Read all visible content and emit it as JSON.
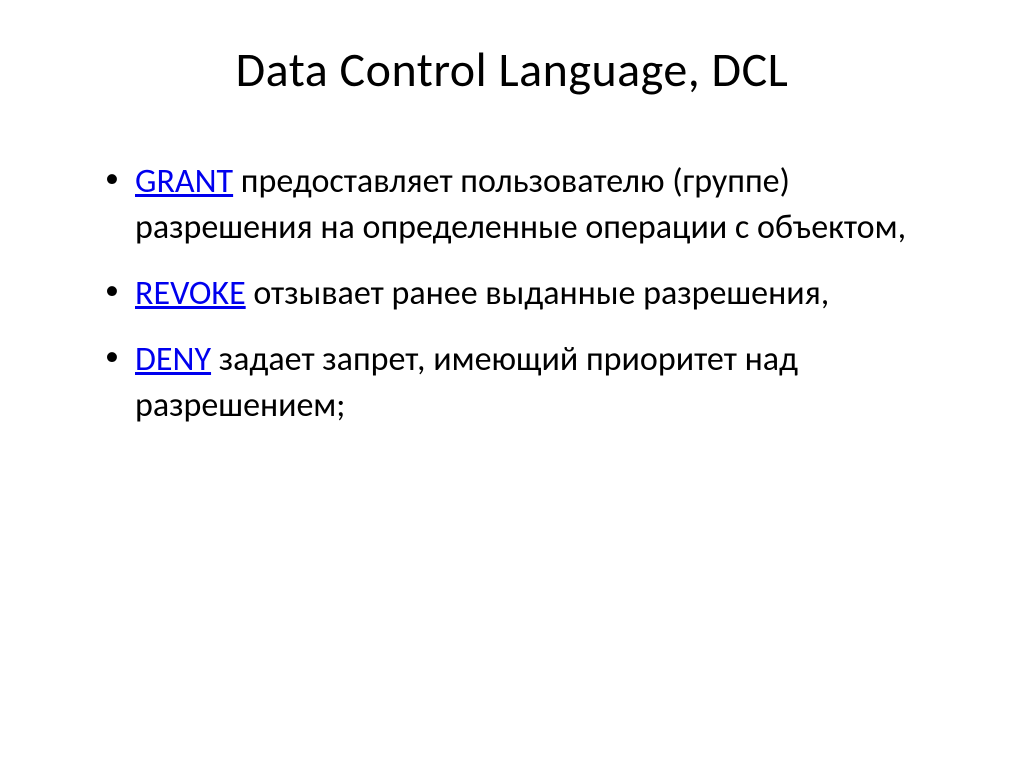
{
  "title": "Data Control Language, DCL",
  "items": [
    {
      "keyword": "GRANT",
      "text": " предоставляет пользователю (группе) разрешения на определенные операции с объектом,"
    },
    {
      "keyword": "REVOKE",
      "text": " отзывает ранее выданные разрешения,"
    },
    {
      "keyword": "DENY",
      "text": " задает запрет, имеющий приоритет над разрешением;"
    }
  ]
}
